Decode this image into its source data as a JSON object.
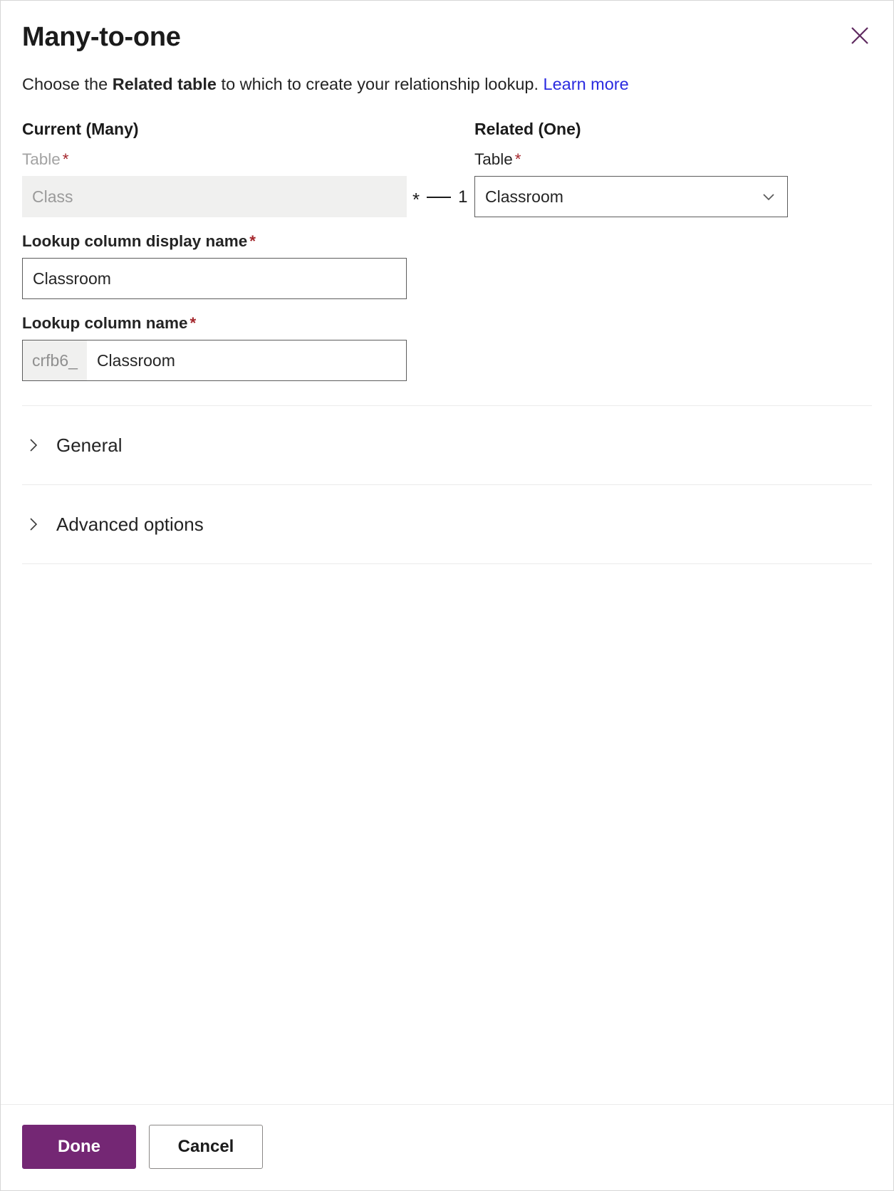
{
  "dialog": {
    "title": "Many-to-one",
    "close_icon": "close-icon",
    "description": {
      "prefix": "Choose the ",
      "bold": "Related table",
      "suffix": " to which to create your relationship lookup. ",
      "link": "Learn more"
    }
  },
  "current_section": {
    "heading": "Current (Many)",
    "table_label": "Table",
    "required_mark": "*",
    "table_value": "Class",
    "table_disabled": true
  },
  "related_section": {
    "heading": "Related (One)",
    "table_label": "Table",
    "required_mark": "*",
    "table_value": "Classroom",
    "chevron_icon": "chevron-down-icon"
  },
  "relation": {
    "many_symbol": "*",
    "one_symbol": "1"
  },
  "lookup_display_name": {
    "label": "Lookup column display name",
    "required_mark": "*",
    "value": "Classroom"
  },
  "lookup_name": {
    "label": "Lookup column name",
    "required_mark": "*",
    "prefix": "crfb6_",
    "value": "Classroom"
  },
  "accordions": [
    {
      "label": "General",
      "chevron_icon": "chevron-right-icon",
      "expanded": false
    },
    {
      "label": "Advanced options",
      "chevron_icon": "chevron-right-icon",
      "expanded": false
    }
  ],
  "footer": {
    "done_label": "Done",
    "cancel_label": "Cancel"
  },
  "colors": {
    "primary": "#742774",
    "link": "#2a2ae0",
    "required": "#a4262c",
    "border": "#5c5c5c",
    "disabled_bg": "#f0f0ef"
  }
}
